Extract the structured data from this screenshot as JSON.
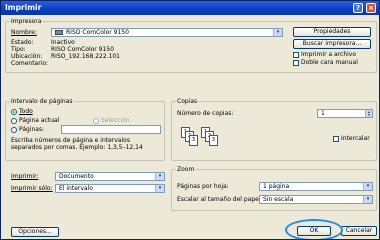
{
  "window": {
    "title": "Imprimir"
  },
  "printer": {
    "group_title": "Impresora",
    "name_label": "Nombre:",
    "name_value": "RISO ComColor 9150",
    "status_label": "Estado:",
    "status_value": "Inactivo",
    "type_label": "Tipo:",
    "type_value": "RISO ComColor 9150",
    "location_label": "Ubicación:",
    "location_value": "RISO_192.168.222.101",
    "comment_label": "Comentario:",
    "properties_button": "Propiedades",
    "find_printer_button": "Buscar impresora...",
    "print_to_file_label": "Imprimir a archivo",
    "duplex_label": "Doble cara manual"
  },
  "page_range": {
    "group_title": "Intervalo de páginas",
    "all_label": "Todo",
    "current_label": "Página actual",
    "selection_label": "Selección",
    "pages_label": "Páginas:",
    "hint": "Escriba números de página e intervalos separados por comas. Ejemplo: 1,3,5–12,14"
  },
  "copies": {
    "group_title": "Copias",
    "number_label": "Número de copias:",
    "number_value": "1",
    "collate_label": "Intercalar",
    "sheet_labels": [
      "1",
      "2",
      "3",
      "1",
      "2",
      "3"
    ]
  },
  "print_what": {
    "print_label": "Imprimir:",
    "print_value": "Documento",
    "print_only_label": "Imprimir sólo:",
    "print_only_value": "El intervalo"
  },
  "zoom": {
    "group_title": "Zoom",
    "pages_per_sheet_label": "Páginas por hoja:",
    "pages_per_sheet_value": "1 página",
    "scale_label": "Escalar al tamaño del papel:",
    "scale_value": "Sin escala"
  },
  "footer": {
    "options_button": "Opciones...",
    "ok_button": "OK",
    "cancel_button": "Cancelar"
  },
  "icons": {
    "help": "?",
    "close": "×",
    "dropdown": "▾",
    "spin_up": "▴",
    "spin_down": "▾"
  },
  "colors": {
    "title_bar": "#0a3ec0",
    "highlight_ring": "#1f8de0"
  }
}
